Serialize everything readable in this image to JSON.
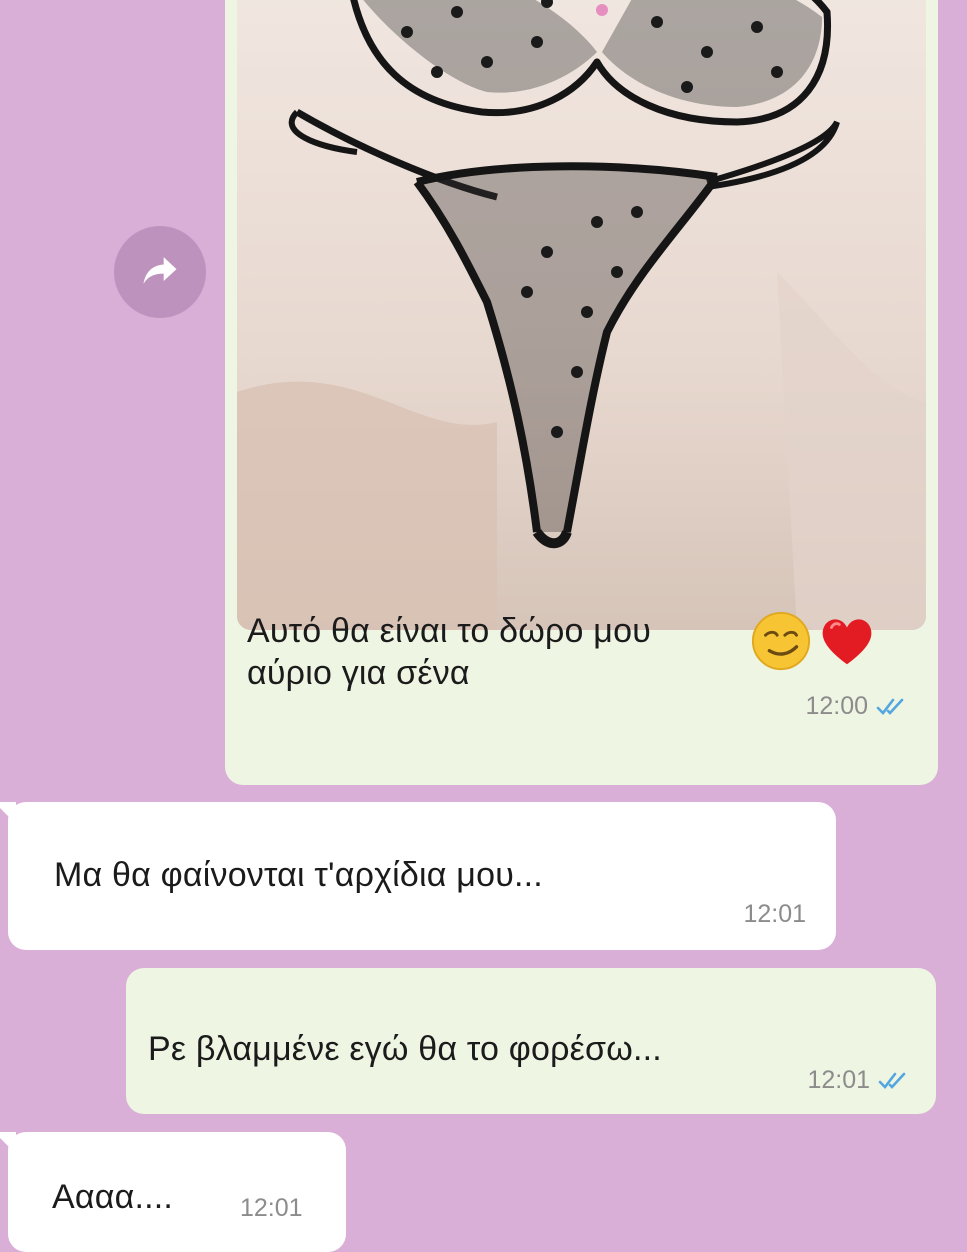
{
  "chat": {
    "messages": [
      {
        "direction": "outgoing",
        "type": "image",
        "image_description_icon": "lingerie-photo",
        "caption_line1": "Αυτό θα είναι το δώρο μου",
        "caption_line2": "αύριο για σένα",
        "emojis": [
          "smirk-emoji",
          "red-heart-emoji"
        ],
        "time": "12:00",
        "status": "read"
      },
      {
        "direction": "incoming",
        "text": "Μα θα φαίνονται τ'αρχίδια μου...",
        "time": "12:01"
      },
      {
        "direction": "outgoing",
        "text": "Ρε βλαμμένε εγώ θα το φορέσω...",
        "time": "12:01",
        "status": "read"
      },
      {
        "direction": "incoming",
        "text": "Αααα....",
        "time": "12:01"
      }
    ],
    "forward_icon": "forward-icon"
  },
  "colors": {
    "background": "#d9afd8",
    "outgoing_bubble": "#eef5e3",
    "incoming_bubble": "#ffffff",
    "forward_button": "#bd93bd",
    "read_ticks": "#53a6e0",
    "time_text": "#8c8c8c"
  }
}
